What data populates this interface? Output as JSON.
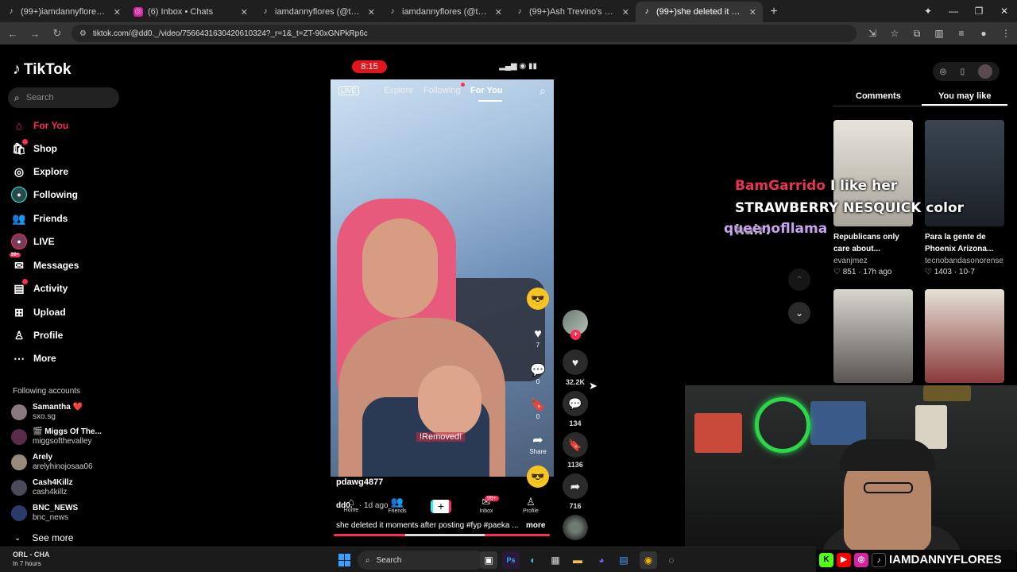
{
  "browser": {
    "tabs": [
      {
        "title": "(99+)iamdannyflores (@theflor",
        "icon": "tiktok-icon"
      },
      {
        "title": "(6) Inbox • Chats",
        "icon": "instagram-icon"
      },
      {
        "title": "iamdannyflores (@thefloresrep",
        "icon": "tiktok-icon"
      },
      {
        "title": "iamdannyflores (@thefloresrep",
        "icon": "tiktok-icon"
      },
      {
        "title": "(99+)Ash Trevino's Response to",
        "icon": "tiktok-icon"
      },
      {
        "title": "(99+)she deleted it moments af",
        "icon": "tiktok-icon",
        "active": true
      }
    ],
    "url": "tiktok.com/@dd0._/video/7566431630420610324?_r=1&_t=ZT-90xGNPkRp6c"
  },
  "sidebar": {
    "logo": "TikTok",
    "search_placeholder": "Search",
    "nav": [
      {
        "label": "For You",
        "icon": "home-icon",
        "active": true
      },
      {
        "label": "Shop",
        "icon": "shop-icon"
      },
      {
        "label": "Explore",
        "icon": "compass-icon"
      },
      {
        "label": "Following",
        "icon": "following-avatar-icon"
      },
      {
        "label": "Friends",
        "icon": "friends-icon"
      },
      {
        "label": "LIVE",
        "icon": "live-avatar-icon"
      },
      {
        "label": "Messages",
        "icon": "messages-icon",
        "badge": "99+"
      },
      {
        "label": "Activity",
        "icon": "activity-icon"
      },
      {
        "label": "Upload",
        "icon": "upload-icon"
      },
      {
        "label": "Profile",
        "icon": "profile-icon"
      },
      {
        "label": "More",
        "icon": "more-icon"
      }
    ],
    "following_title": "Following accounts",
    "following": [
      {
        "name": "Samantha ❤️",
        "user": "sxo.sg"
      },
      {
        "name": "🎬 Miggs Of The...",
        "user": "miggsofthevalley"
      },
      {
        "name": "Arely",
        "user": "arelyhinojosaa06"
      },
      {
        "name": "Cash4Killz",
        "user": "cash4killz"
      },
      {
        "name": "BNC_NEWS",
        "user": "bnc_news"
      }
    ],
    "see_more": "See more"
  },
  "phone": {
    "time": "8:15",
    "top_tabs": {
      "live": "LIVE",
      "explore": "Explore",
      "following": "Following",
      "foryou": "For You"
    },
    "inner_stats": {
      "likes": "7",
      "comments": "0",
      "saves": "0",
      "share": "Share"
    },
    "removed_text": "!Removed!",
    "username": "pdawg4877",
    "overlay_user": "dd0._",
    "overlay_time": "· 1d ago",
    "bottom_nav": {
      "home": "Home",
      "friends": "Friends",
      "inbox": "Inbox",
      "inbox_badge": "99+",
      "profile": "Profile"
    },
    "caption": "she deleted it moments after posting #fyp #paeka ...",
    "more": "more",
    "progress": 0.33
  },
  "actions": {
    "likes": "32.2K",
    "comments": "134",
    "saves": "1136",
    "shares": "716"
  },
  "right_panel": {
    "tabs": {
      "comments": "Comments",
      "you_may_like": "You may like"
    },
    "cards": [
      {
        "title": "Republicans only care about...",
        "author": "evanjmez",
        "likes": "851",
        "age": "17h ago"
      },
      {
        "title": "Para la gente de Phoenix Arizona...",
        "author": "tecnobandasonorense",
        "likes": "1403",
        "age": "10-7"
      }
    ]
  },
  "chat": [
    {
      "user": "BamGarrido",
      "message": "I like her STRAWBERRY NESQUICK color hair!",
      "color": "#e8334f"
    },
    {
      "user": "queenofllama",
      "message": "",
      "color": "#c9a2f2"
    }
  ],
  "stream": {
    "handle": "IAMDANNYFLORES"
  },
  "taskbar": {
    "weather_title": "ORL - CHA",
    "weather_sub": "In 7 hours",
    "search": "Search"
  }
}
